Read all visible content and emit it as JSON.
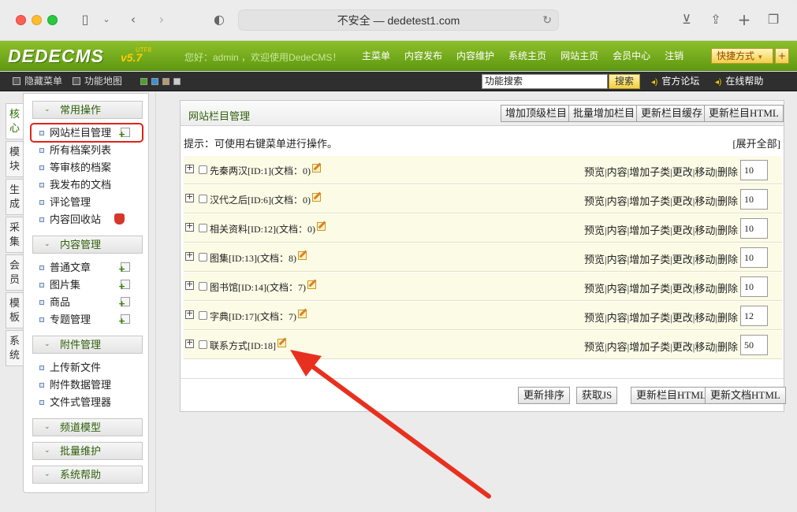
{
  "browser": {
    "url_text": "不安全 — dedetest1.com"
  },
  "header": {
    "logo_text": "DEDECMS",
    "logo_version": "v5.7",
    "logo_edition": "UTF8",
    "greeting": "您好：admin ，欢迎使用DedeCMS！",
    "nav": [
      "主菜单",
      "内容发布",
      "内容维护",
      "系统主页",
      "网站主页",
      "会员中心",
      "注销"
    ],
    "quick_label": "快捷方式",
    "quick_plus": "+"
  },
  "toolbar": {
    "hide_menu": "隐藏菜单",
    "sitemap": "功能地图",
    "search_value": "功能搜索",
    "search_button": "搜索",
    "forum_link": "官方论坛",
    "help_link": "在线帮助",
    "swatch_colors": [
      "#4aa12a",
      "#3a8fd8",
      "#b89a72",
      "#cccccc"
    ]
  },
  "vtabs": [
    "核心",
    "模块",
    "生成",
    "采集",
    "会员",
    "模板",
    "系统"
  ],
  "leftmenu": {
    "groups": [
      {
        "title": "常用操作",
        "items": [
          "网站栏目管理",
          "所有档案列表",
          "等审核的档案",
          "我发布的文档",
          "评论管理",
          "内容回收站"
        ]
      },
      {
        "title": "内容管理",
        "items": [
          "普通文章",
          "图片集",
          "商品",
          "专题管理"
        ]
      },
      {
        "title": "附件管理",
        "items": [
          "上传新文件",
          "附件数据管理",
          "文件式管理器"
        ]
      },
      {
        "title": "频道模型"
      },
      {
        "title": "批量维护"
      },
      {
        "title": "系统帮助"
      }
    ]
  },
  "main": {
    "title": "网站栏目管理",
    "header_buttons": [
      "增加顶级栏目",
      "批量增加栏目",
      "更新栏目缓存",
      "更新栏目HTML"
    ],
    "tip": "提示：可使用右键菜单进行操作。",
    "expand_all": "[展开全部]",
    "ops": "预览|内容|增加子类|更改|移动|删除",
    "rows": [
      {
        "name": "先秦两汉[ID:1](文档：0)",
        "order": "10"
      },
      {
        "name": "汉代之后[ID:6](文档：0)",
        "order": "10"
      },
      {
        "name": "相关资料[ID:12](文档：0)",
        "order": "10"
      },
      {
        "name": "图集[ID:13](文档：8)",
        "order": "10"
      },
      {
        "name": "图书馆[ID:14](文档：7)",
        "order": "10"
      },
      {
        "name": "字典[ID:17](文档：7)",
        "order": "12"
      },
      {
        "name": "联系方式[ID:18]",
        "order": "50"
      }
    ],
    "footer_buttons": [
      "更新排序",
      "获取JS",
      "更新栏目HTML",
      "更新文档HTML"
    ]
  },
  "colors": {
    "header_green": "#6fa81b",
    "annotation_red": "#e8301f"
  }
}
